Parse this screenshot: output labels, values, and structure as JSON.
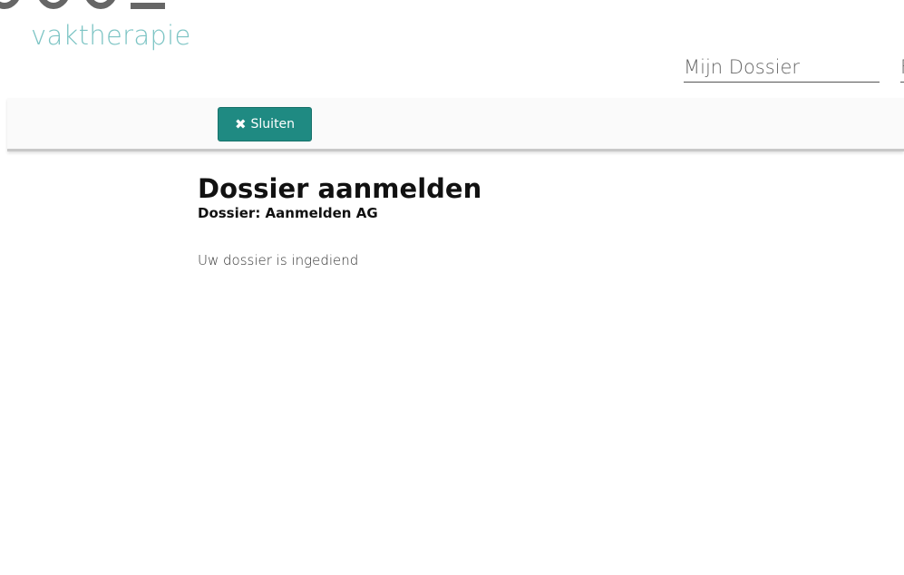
{
  "header": {
    "logo_text": "vaktherapie",
    "nav": {
      "mijn_dossier": "Mijn Dossier",
      "next_item": "F"
    }
  },
  "toolbar": {
    "close_label": "Sluiten",
    "close_icon": "✖"
  },
  "main": {
    "title": "Dossier aanmelden",
    "subtitle": "Dossier: Aanmelden AG",
    "message": "Uw dossier is ingediend"
  },
  "colors": {
    "brand_teal": "#7cc4c4",
    "button_teal": "#1f8a82"
  }
}
